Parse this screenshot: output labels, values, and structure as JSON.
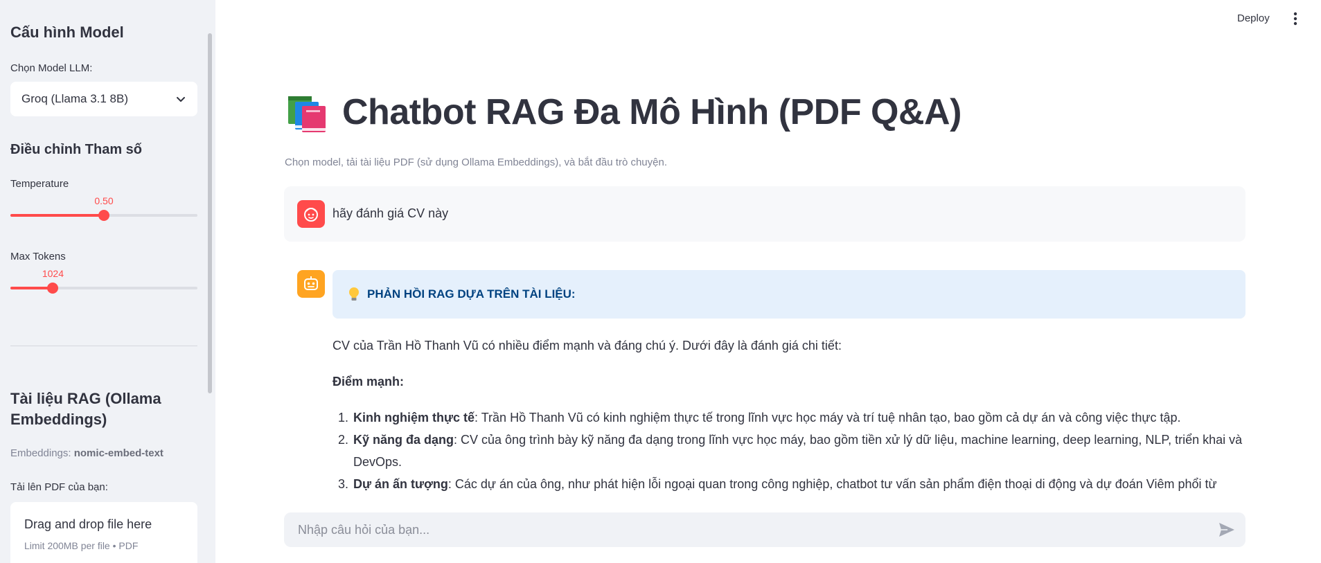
{
  "sidebar": {
    "model_config_title": "Cấu hình Model",
    "choose_model_label": "Chọn Model LLM:",
    "selected_model": "Groq (Llama 3.1 8B)",
    "params_title": "Điều chỉnh Tham số",
    "temperature": {
      "label": "Temperature",
      "value_text": "0.50",
      "value": 0.5,
      "min": 0,
      "max": 1
    },
    "max_tokens": {
      "label": "Max Tokens",
      "value_text": "1024",
      "value": 1024,
      "min": 0,
      "max": 4500
    },
    "rag_title": "Tài liệu RAG (Ollama Embeddings)",
    "embeddings_prefix": "Embeddings: ",
    "embeddings_model": "nomic-embed-text",
    "upload_label": "Tải lên PDF của bạn:",
    "uploader": {
      "title": "Drag and drop file here",
      "subtitle": "Limit 200MB per file • PDF"
    }
  },
  "header": {
    "deploy_label": "Deploy"
  },
  "main": {
    "title": "Chatbot RAG Đa Mô Hình (PDF Q&A)",
    "caption": "Chọn model, tải tài liệu PDF (sử dụng Ollama Embeddings), và bắt đầu trò chuyện.",
    "user_message": "hãy đánh giá CV này",
    "assistant": {
      "info_header": "PHẢN HỒI RAG DỰA TRÊN TÀI LIỆU:",
      "intro": "CV của Trần Hồ Thanh Vũ có nhiều điểm mạnh và đáng chú ý. Dưới đây là đánh giá chi tiết:",
      "strengths_heading": "Điểm mạnh:",
      "items": [
        {
          "title": "Kinh nghiệm thực tế",
          "text": ": Trần Hồ Thanh Vũ có kinh nghiệm thực tế trong lĩnh vực học máy và trí tuệ nhân tạo, bao gồm cả dự án và công việc thực tập."
        },
        {
          "title": "Kỹ năng đa dạng",
          "text": ": CV của ông trình bày kỹ năng đa dạng trong lĩnh vực học máy, bao gồm tiền xử lý dữ liệu, machine learning, deep learning, NLP, triển khai và DevOps."
        },
        {
          "title": "Dự án ấn tượng",
          "text": ": Các dự án của ông, như phát hiện lỗi ngoại quan trong công nghiệp, chatbot tư vấn sản phẩm điện thoại di động và dự đoán Viêm phổi từ"
        }
      ]
    },
    "chat_input_placeholder": "Nhập câu hỏi của bạn..."
  },
  "colors": {
    "accent": "#ff4b4b",
    "info_bg": "#e5f0fc",
    "info_text": "#004280",
    "bot_avatar": "#ffa421"
  }
}
